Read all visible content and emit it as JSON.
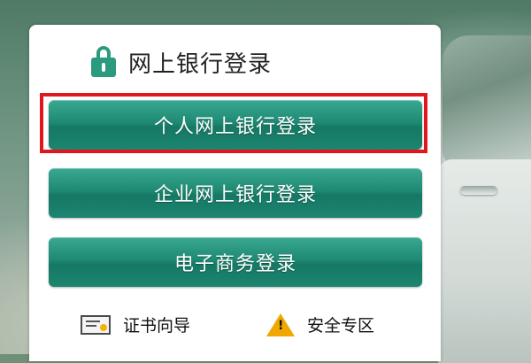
{
  "header": {
    "title": "网上银行登录"
  },
  "buttons": {
    "personal": "个人网上银行登录",
    "enterprise": "企业网上银行登录",
    "ecommerce": "电子商务登录"
  },
  "footer": {
    "certificate_guide": "证书向导",
    "security_zone": "安全专区"
  },
  "icons": {
    "title": "lock-icon",
    "certificate": "certificate-icon",
    "security": "warning-icon"
  },
  "colors": {
    "accent": "#1f8a73",
    "highlight_border": "#e0181e",
    "lock": "#2c9a7f",
    "warning": "#f0a800"
  }
}
